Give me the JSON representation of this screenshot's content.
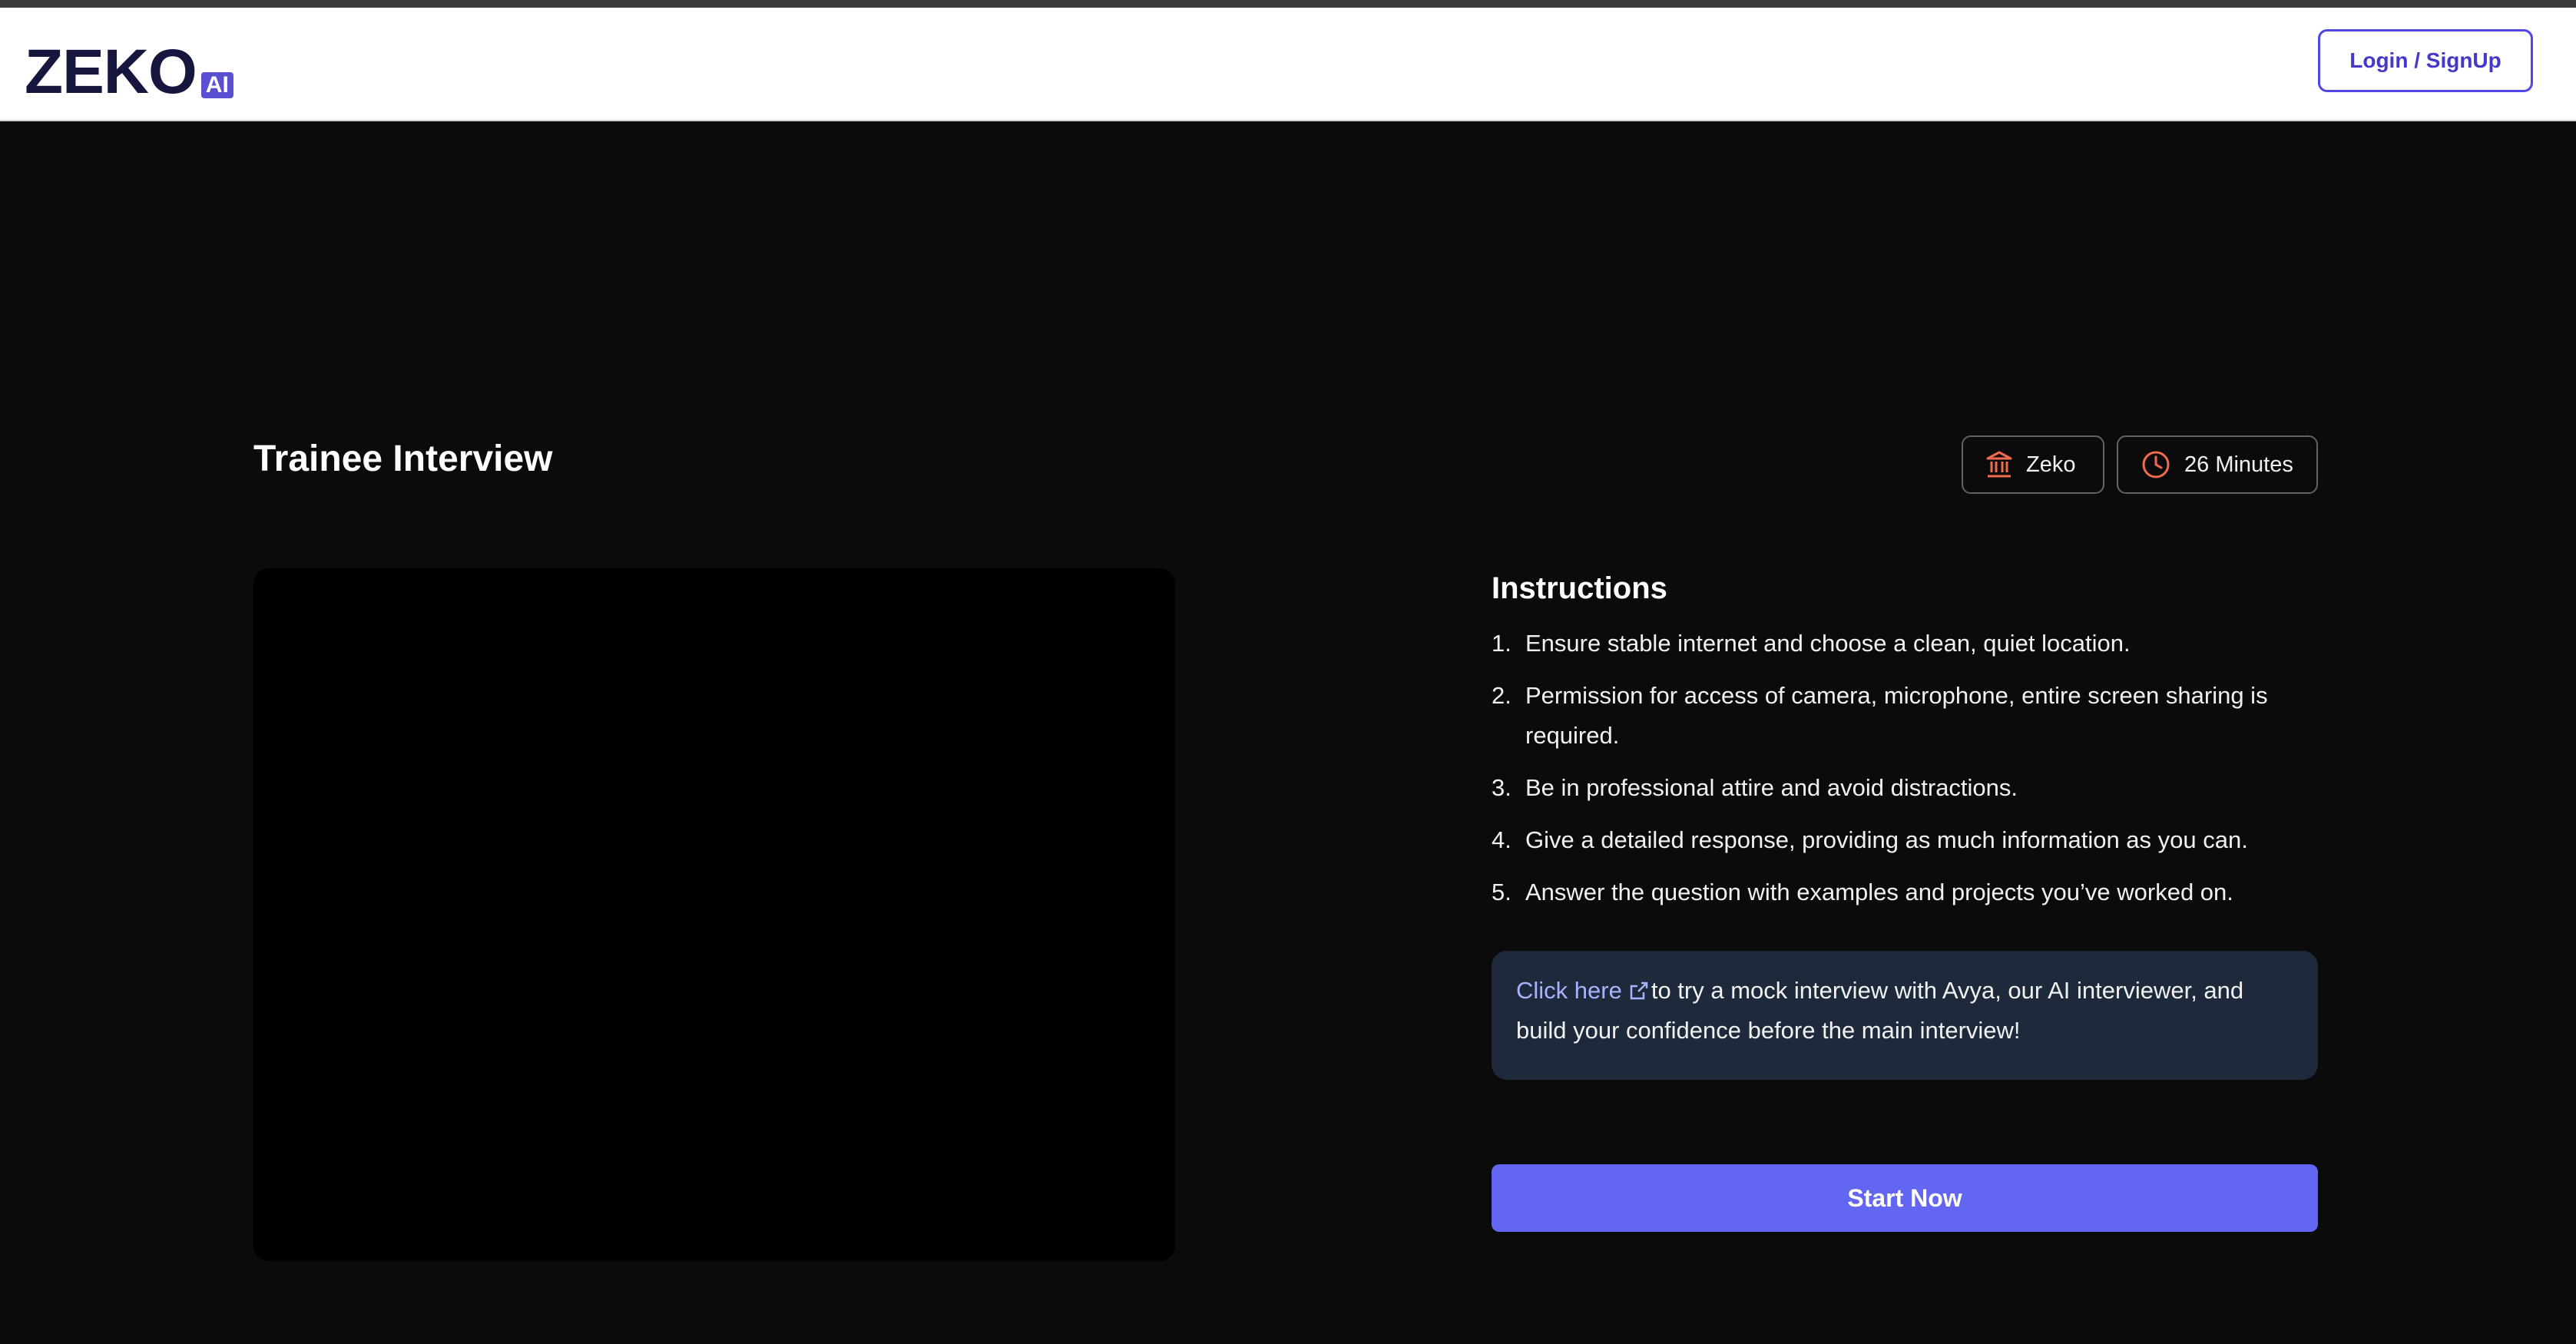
{
  "header": {
    "logo_text": "ZEKO",
    "logo_badge": "AI",
    "login_label": "Login / SignUp"
  },
  "interview": {
    "title": "Trainee Interview",
    "company": "Zeko",
    "duration": "26 Minutes"
  },
  "instructions": {
    "heading": "Instructions",
    "items": [
      {
        "num": "1.",
        "text": "Ensure stable internet and choose a clean, quiet location."
      },
      {
        "num": "2.",
        "text": "Permission for access of camera, microphone, entire screen sharing is required."
      },
      {
        "num": "3.",
        "text": "Be in professional attire and avoid distractions."
      },
      {
        "num": "4.",
        "text": "Give a detailed response, providing as much information as you can."
      },
      {
        "num": "5.",
        "text": "Answer the question with examples and projects you’ve worked on."
      }
    ]
  },
  "mock": {
    "link_label": "Click here",
    "text": "to try a mock interview with Avya, our AI interviewer, and build your confidence before the main interview!"
  },
  "start_label": "Start Now",
  "colors": {
    "accent": "#6366f1",
    "background": "#0b0b0b",
    "mock_box": "#1e293b",
    "badge_icon": "#f26b4f"
  },
  "icons": {
    "company": "bank-building-icon",
    "duration": "clock-icon",
    "external_link": "external-link-icon"
  }
}
